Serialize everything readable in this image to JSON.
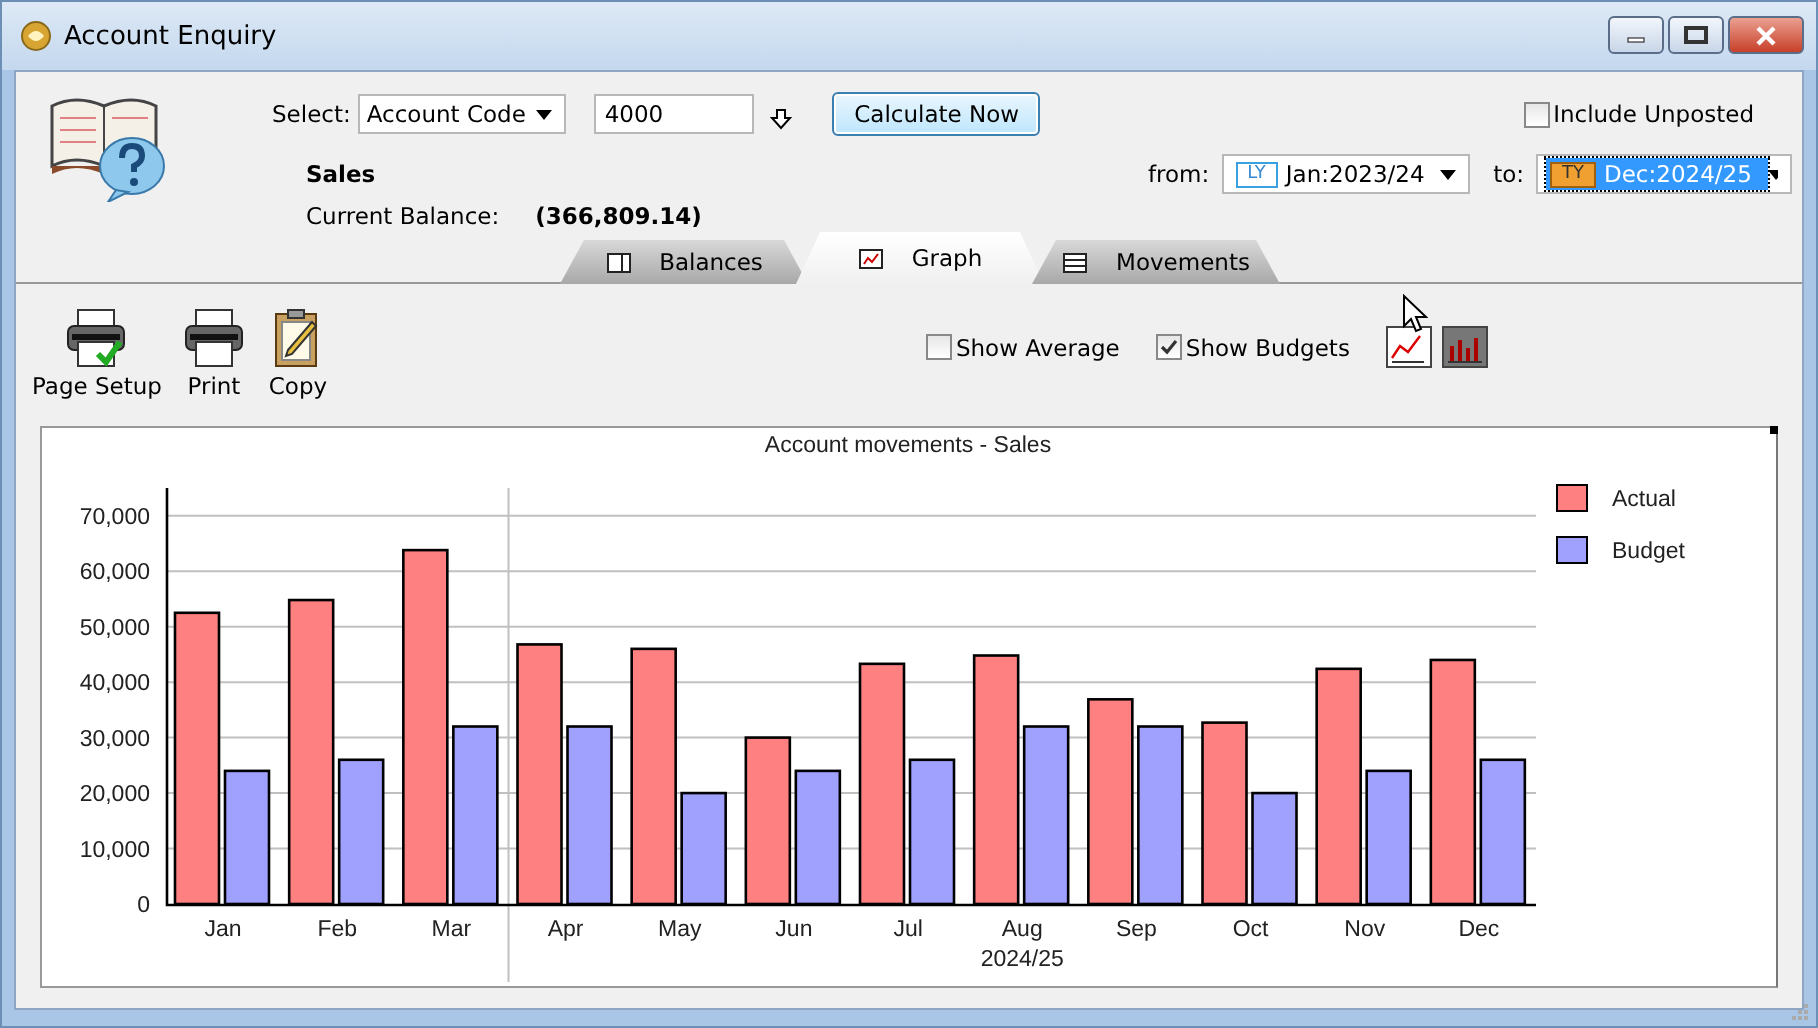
{
  "window": {
    "title": "Account Enquiry"
  },
  "selector": {
    "label": "Select:",
    "type": "Account Code",
    "code": "4000"
  },
  "calculate_button": "Calculate Now",
  "include_unposted": {
    "label": "Include Unposted",
    "checked": false
  },
  "account": {
    "name": "Sales",
    "balance_label": "Current Balance:",
    "balance": "(366,809.14)"
  },
  "period": [
    {
      "label": "from:",
      "badge": "LY",
      "value": "Jan:2023/24",
      "selected": false
    },
    {
      "label": "to:",
      "badge": "TY",
      "value": "Dec:2024/25",
      "selected": true
    }
  ],
  "tabs": [
    {
      "label": "Balances",
      "kind": "table",
      "selected": false
    },
    {
      "label": "Graph",
      "kind": "graph",
      "selected": true
    },
    {
      "label": "Movements",
      "kind": "list",
      "selected": false
    }
  ],
  "toolbar": [
    {
      "label": "Page Setup",
      "kind": "page-setup"
    },
    {
      "label": "Print",
      "kind": "print"
    },
    {
      "label": "Copy",
      "kind": "copy"
    }
  ],
  "options": [
    {
      "label": "Show Average",
      "checked": false
    },
    {
      "label": "Show Budgets",
      "checked": true
    }
  ],
  "chart_types": [
    {
      "kind": "line",
      "selected": false
    },
    {
      "kind": "bar",
      "selected": true
    }
  ],
  "graph": {
    "period_label": "2024/25",
    "chart_data": {
      "type": "bar",
      "title": "Account movements - Sales",
      "categories": [
        "Jan",
        "Feb",
        "Mar",
        "Apr",
        "May",
        "Jun",
        "Jul",
        "Aug",
        "Sep",
        "Oct",
        "Nov",
        "Dec"
      ],
      "series": [
        {
          "name": "Actual",
          "color": "#ff8080",
          "values": [
            52500,
            54800,
            63800,
            46800,
            46000,
            30000,
            43300,
            44800,
            36900,
            32700,
            42400,
            44000
          ]
        },
        {
          "name": "Budget",
          "color": "#a0a0ff",
          "values": [
            24000,
            26000,
            32000,
            32000,
            20000,
            24000,
            26000,
            32000,
            32000,
            20000,
            24000,
            26000
          ]
        }
      ],
      "grid": true,
      "legend": true,
      "ylim": [
        0,
        75000
      ],
      "yticks": [
        {
          "value": 0,
          "label": "0"
        },
        {
          "value": 10000,
          "label": "10,000"
        },
        {
          "value": 20000,
          "label": "20,000"
        },
        {
          "value": 30000,
          "label": "30,000"
        },
        {
          "value": 40000,
          "label": "40,000"
        },
        {
          "value": 50000,
          "label": "50,000"
        },
        {
          "value": 60000,
          "label": "60,000"
        },
        {
          "value": 70000,
          "label": "70,000"
        }
      ]
    }
  }
}
